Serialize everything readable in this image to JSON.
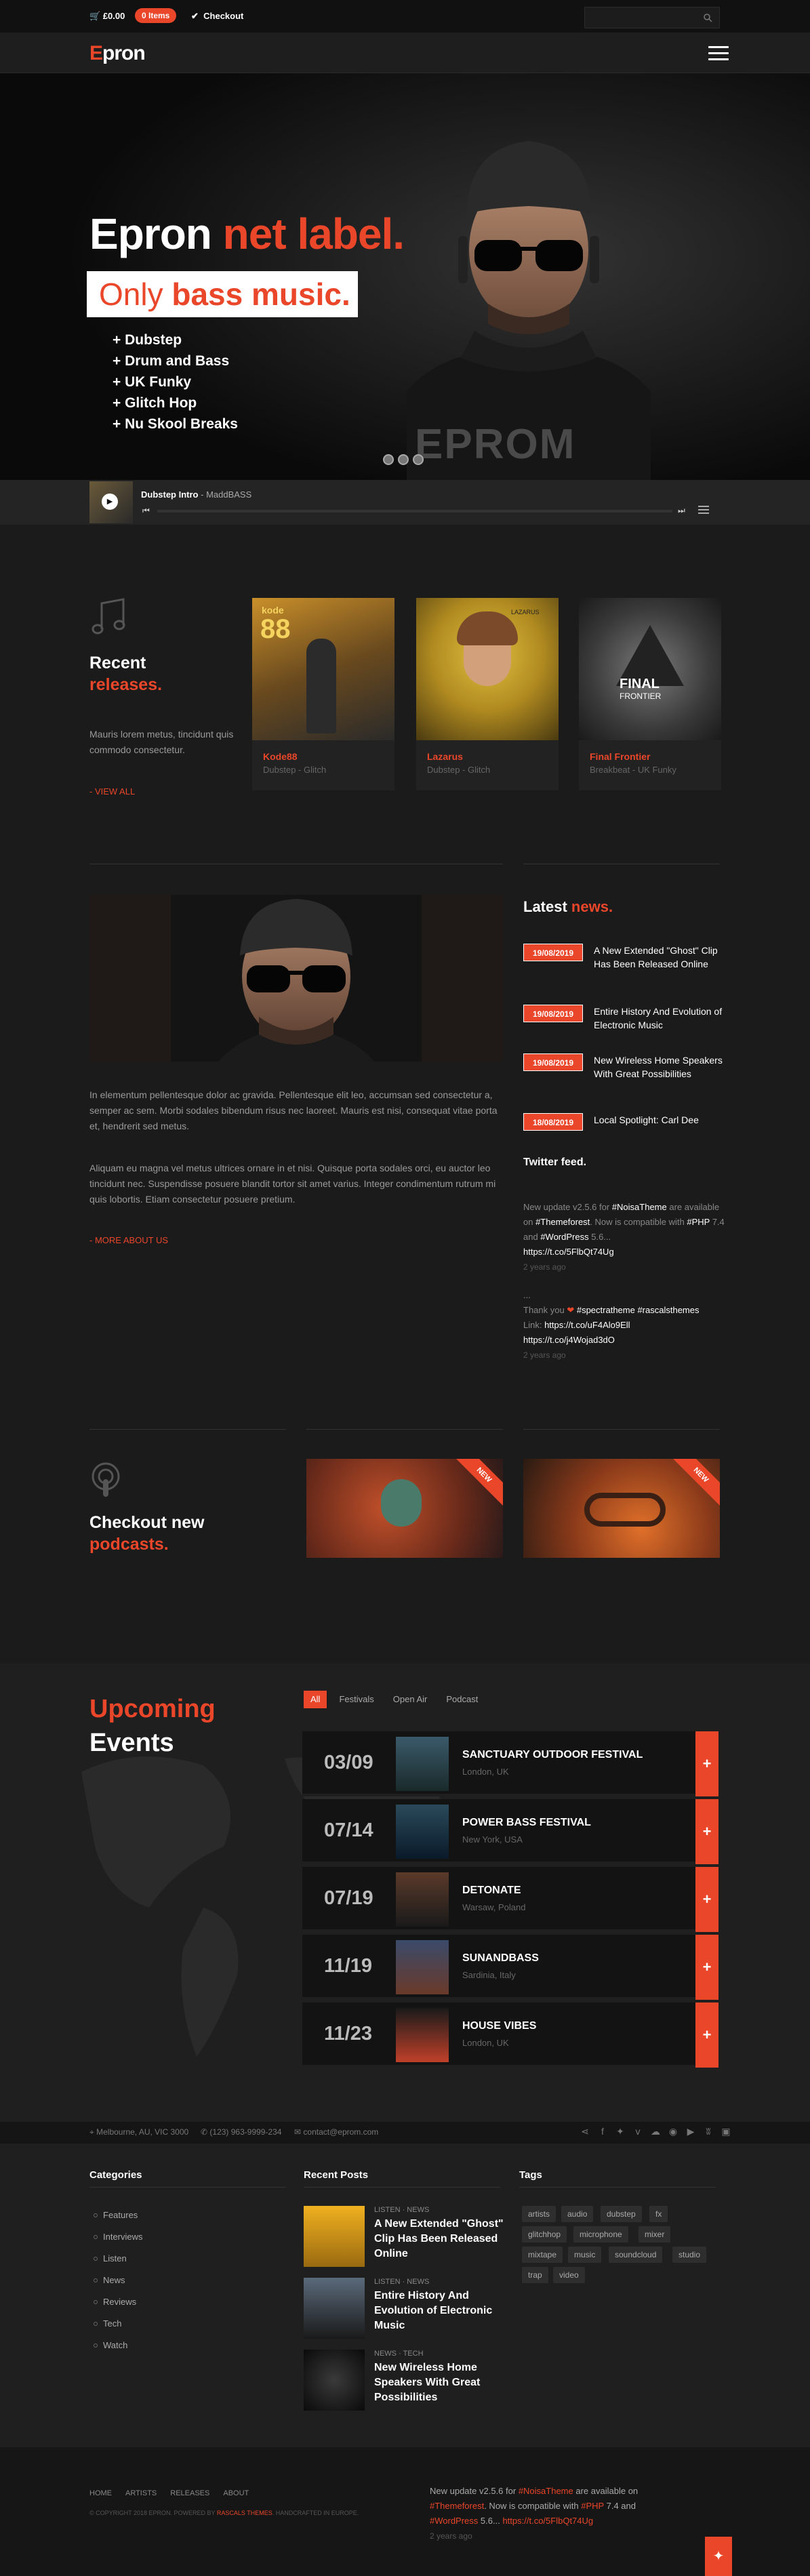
{
  "topbar": {
    "cart": "£0.00",
    "items": "0 Items",
    "checkout": "Checkout",
    "search_placeholder": ""
  },
  "nav": {
    "logo_a": "E",
    "logo_b": "pron"
  },
  "hero": {
    "title_a": "Epron ",
    "title_b": "net label.",
    "sub_a": "Only ",
    "sub_b": "bass music.",
    "genres": [
      "+ Dubstep",
      "+ Drum and Bass",
      "+ UK Funky",
      "+ Glitch Hop",
      "+ Nu Skool Breaks"
    ],
    "watermark": "EPROM"
  },
  "player": {
    "track": "Dubstep Intro",
    "artist": "- MaddBASS"
  },
  "recent": {
    "title_a": "Recent",
    "title_b": "releases.",
    "text": "Mauris lorem metus, tincidunt quis commodo consectetur.",
    "more": "- VIEW ALL",
    "items": [
      {
        "title": "Kode88",
        "genre": "Dubstep - Glitch"
      },
      {
        "title": "Lazarus",
        "genre": "Dubstep - Glitch"
      },
      {
        "title": "Final Frontier",
        "genre": "Breakbeat - UK Funky"
      }
    ],
    "art_text": [
      "kode",
      "88",
      "LAZARUS",
      "FINAL",
      "FRONTIER"
    ]
  },
  "about": {
    "p1": "In elementum pellentesque dolor ac gravida. Pellentesque elit leo, accumsan sed consectetur a, semper ac sem. Morbi sodales bibendum risus nec laoreet. Mauris est nisi, consequat vitae porta et, hendrerit sed metus.",
    "p2": "Aliquam eu magna vel metus ultrices ornare in et nisi. Quisque porta sodales orci, eu auctor leo tincidunt nec. Suspendisse posuere blandit tortor sit amet varius. Integer condimentum rutrum mi quis lobortis. Etiam consectetur posuere pretium.",
    "more": "- MORE ABOUT US"
  },
  "news": {
    "title_a": "Latest ",
    "title_b": "news.",
    "items": [
      {
        "date": "19/08/2019",
        "title": "A New Extended \"Ghost\" Clip Has Been Released Online"
      },
      {
        "date": "19/08/2019",
        "title": "Entire History And Evolution of Electronic Music"
      },
      {
        "date": "19/08/2019",
        "title": "New Wireless Home Speakers With Great Possibilities"
      },
      {
        "date": "18/08/2019",
        "title": "Local Spotlight: Carl Dee"
      }
    ]
  },
  "twitter": {
    "title": "Twitter feed.",
    "t1_a": "New update v2.5.6 for ",
    "t1_b": "#NoisaTheme",
    "t1_c": " are available on ",
    "t1_d": "#Themeforest",
    "t1_e": ". Now is compatible with ",
    "t1_f": "#PHP",
    "t1_g": " 7.4 and ",
    "t1_h": "#WordPress",
    "t1_i": " 5.6...",
    "t1_link": "https://t.co/5FlbQt74Ug",
    "t1_ago": "2 years ago",
    "dots": "...",
    "t2_a": "Thank you ",
    "t2_heart": "❤",
    "t2_b": " #spectratheme",
    "t2_c": " #rascalsthemes",
    "t2_d": " Link: ",
    "t2_link1": "https://t.co/uF4Alo9Ell",
    "t2_link2": "https://t.co/j4Wojad3dO",
    "t2_ago": "2 years ago"
  },
  "podcasts": {
    "title_a": "Checkout new",
    "title_b": "podcasts.",
    "ribbon": "NEW"
  },
  "events": {
    "title_a": "Upcoming",
    "title_b": "Events",
    "filters": [
      "All",
      "Festivals",
      "Open Air",
      "Podcast"
    ],
    "items": [
      {
        "date": "03/09",
        "name": "SANCTUARY OUTDOOR FESTIVAL",
        "loc": "London, UK"
      },
      {
        "date": "07/14",
        "name": "POWER BASS FESTIVAL",
        "loc": "New York, USA"
      },
      {
        "date": "07/19",
        "name": "DETONATE",
        "loc": "Warsaw, Poland"
      },
      {
        "date": "11/19",
        "name": "SUNANDBASS",
        "loc": "Sardinia, Italy"
      },
      {
        "date": "11/23",
        "name": "HOUSE VIBES",
        "loc": "London, UK"
      }
    ],
    "plus": "+"
  },
  "contact": {
    "address": "Melbourne, AU, VIC 3000",
    "phone": "(123) 963-9999-234",
    "email": "contact@eprom.com"
  },
  "footer": {
    "categories_title": "Categories",
    "categories": [
      "Features",
      "Interviews",
      "Listen",
      "News",
      "Reviews",
      "Tech",
      "Watch"
    ],
    "posts_title": "Recent Posts",
    "posts": [
      {
        "meta": "LISTEN · NEWS",
        "title": "A New Extended \"Ghost\" Clip Has Been Released Online"
      },
      {
        "meta": "LISTEN · NEWS",
        "title": "Entire History And Evolution of Electronic Music"
      },
      {
        "meta": "NEWS · TECH",
        "title": "New Wireless Home Speakers With Great Possibilities"
      }
    ],
    "tags_title": "Tags",
    "tags": [
      "artists",
      "audio",
      "dubstep",
      "fx",
      "glitchhop",
      "microphone",
      "mixer",
      "mixtape",
      "music",
      "soundcloud",
      "studio",
      "trap",
      "video"
    ],
    "nav": [
      "HOME",
      "ARTISTS",
      "RELEASES",
      "ABOUT"
    ],
    "copyright_a": "© COPYRIGHT 2018 EPRON. POWERED BY ",
    "copyright_b": "RASCALS THEMES",
    "copyright_c": ". HANDCRAFTED IN EUROPE.",
    "tw_ago": "2 years ago",
    "top": "▲"
  },
  "colors": {
    "accent": "#e9462a",
    "bg": "#1a1a1a"
  }
}
